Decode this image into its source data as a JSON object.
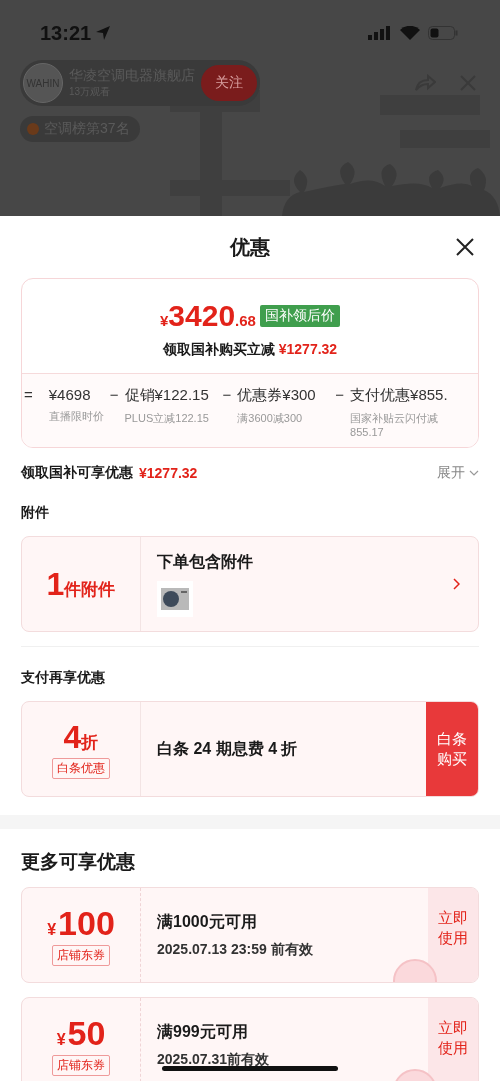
{
  "status_bar": {
    "time": "13:21"
  },
  "live": {
    "store_logo": "WAHIN",
    "store_name": "华凌空调电器旗舰店",
    "viewers": "13万观看",
    "follow_button": "关注",
    "rank_badge": "空调榜第37名"
  },
  "sheet": {
    "title": "优惠"
  },
  "price_card": {
    "symbol": "¥",
    "integer": "3420",
    "decimal": ".68",
    "tag": "国补领后价",
    "saving_label": "领取国补购买立减",
    "saving_amount": "¥1277.32",
    "breakdown": [
      {
        "operator": "=",
        "amount": "¥4698",
        "note": "直播限时价"
      },
      {
        "operator": "−",
        "label": "促销",
        "amount": "¥122.15",
        "note": "PLUS立减122.15"
      },
      {
        "operator": "−",
        "label": "优惠券",
        "amount": "¥300",
        "note": "满3600减300"
      },
      {
        "operator": "−",
        "label": "支付优惠",
        "amount": "¥855.",
        "note": "国家补贴云闪付减855.17"
      }
    ]
  },
  "subsidy_row": {
    "label": "领取国补可享优惠",
    "amount": "¥1277.32",
    "toggle": "展开"
  },
  "accessories": {
    "heading": "附件",
    "count": "1",
    "count_unit": "件附件",
    "title": "下单包含附件"
  },
  "payment": {
    "heading": "支付再享优惠",
    "discount": "4",
    "discount_unit": "折",
    "tag": "白条优惠",
    "title": "白条 24 期息费 4 折",
    "button": "白条购买"
  },
  "more": {
    "heading": "更多可享优惠",
    "coupons": [
      {
        "symbol": "¥",
        "amount": "100",
        "tag": "店铺东券",
        "condition": "满1000元可用",
        "validity": "2025.07.13 23:59 前有效",
        "button": "立即使用",
        "claimed": true
      },
      {
        "symbol": "¥",
        "amount": "50",
        "tag": "店铺东券",
        "condition": "满999元可用",
        "validity": "2025.07.31前有效",
        "button": "立即使用",
        "claimed": true
      }
    ]
  }
}
